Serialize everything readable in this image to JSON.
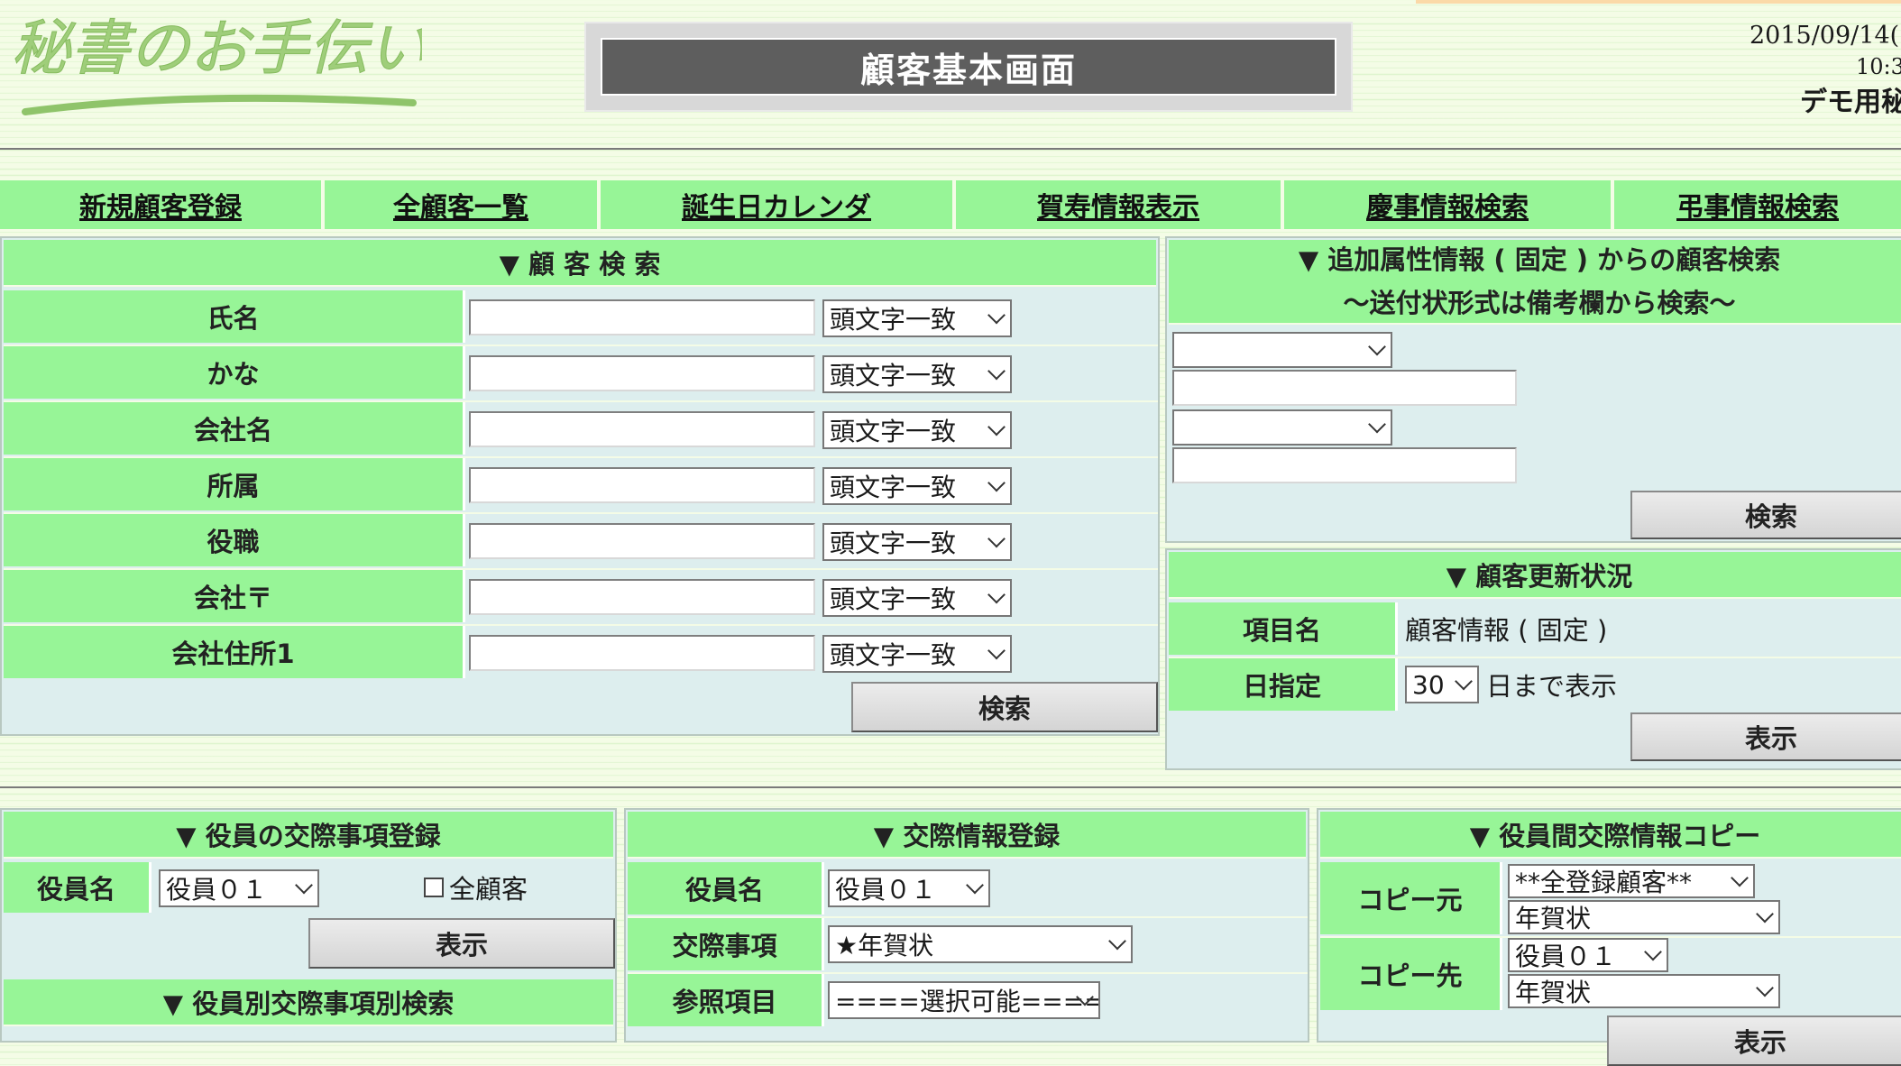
{
  "header": {
    "logo_text": "秘書のお手伝い",
    "title": "顧客基本画面",
    "date": "2015/09/14(",
    "time": "10:3",
    "user": "デモ用秘"
  },
  "nav": [
    "新規顧客登録",
    "全顧客一覧",
    "誕生日カレンダ",
    "賀寿情報表示",
    "慶事情報検索",
    "弔事情報検索"
  ],
  "customer_search": {
    "heading": "▼ 顧 客 検 索",
    "match_option": "頭文字一致",
    "fields": [
      "氏名",
      "かな",
      "会社名",
      "所属",
      "役職",
      "会社〒",
      "会社住所1"
    ],
    "button": "検索"
  },
  "attr_search": {
    "heading_line1": "▼ 追加属性情報 ( 固定 ) からの顧客検索",
    "heading_line2": "～送付状形式は備考欄から検索～",
    "button": "検索"
  },
  "update_status": {
    "heading": "▼ 顧客更新状況",
    "item_label": "項目名",
    "item_value": "顧客情報 ( 固定 )",
    "day_label": "日指定",
    "day_value": "30",
    "day_suffix": "日まで表示",
    "button": "表示"
  },
  "officer_register": {
    "heading": "▼ 役員の交際事項登録",
    "officer_label": "役員名",
    "officer_value": "役員０１",
    "all_customers": "全顧客",
    "button": "表示",
    "heading2": "▼ 役員別交際事項別検索"
  },
  "relation_register": {
    "heading": "▼ 交際情報登録",
    "officer_label": "役員名",
    "officer_value": "役員０１",
    "item_label": "交際事項",
    "item_value": "★年賀状",
    "ref_label": "参照項目",
    "ref_value": "====選択可能===="
  },
  "copy": {
    "heading": "▼ 役員間交際情報コピー",
    "from_label": "コピー元",
    "from_value1": "**全登録顧客**",
    "from_value2": "年賀状",
    "to_label": "コピー先",
    "to_value1": "役員０１",
    "to_value2": "年賀状",
    "button": "表示"
  },
  "colors": {
    "accent_green": "#97f597",
    "panel_bg": "#ddeeee",
    "title_bg": "#5e5e5e"
  }
}
